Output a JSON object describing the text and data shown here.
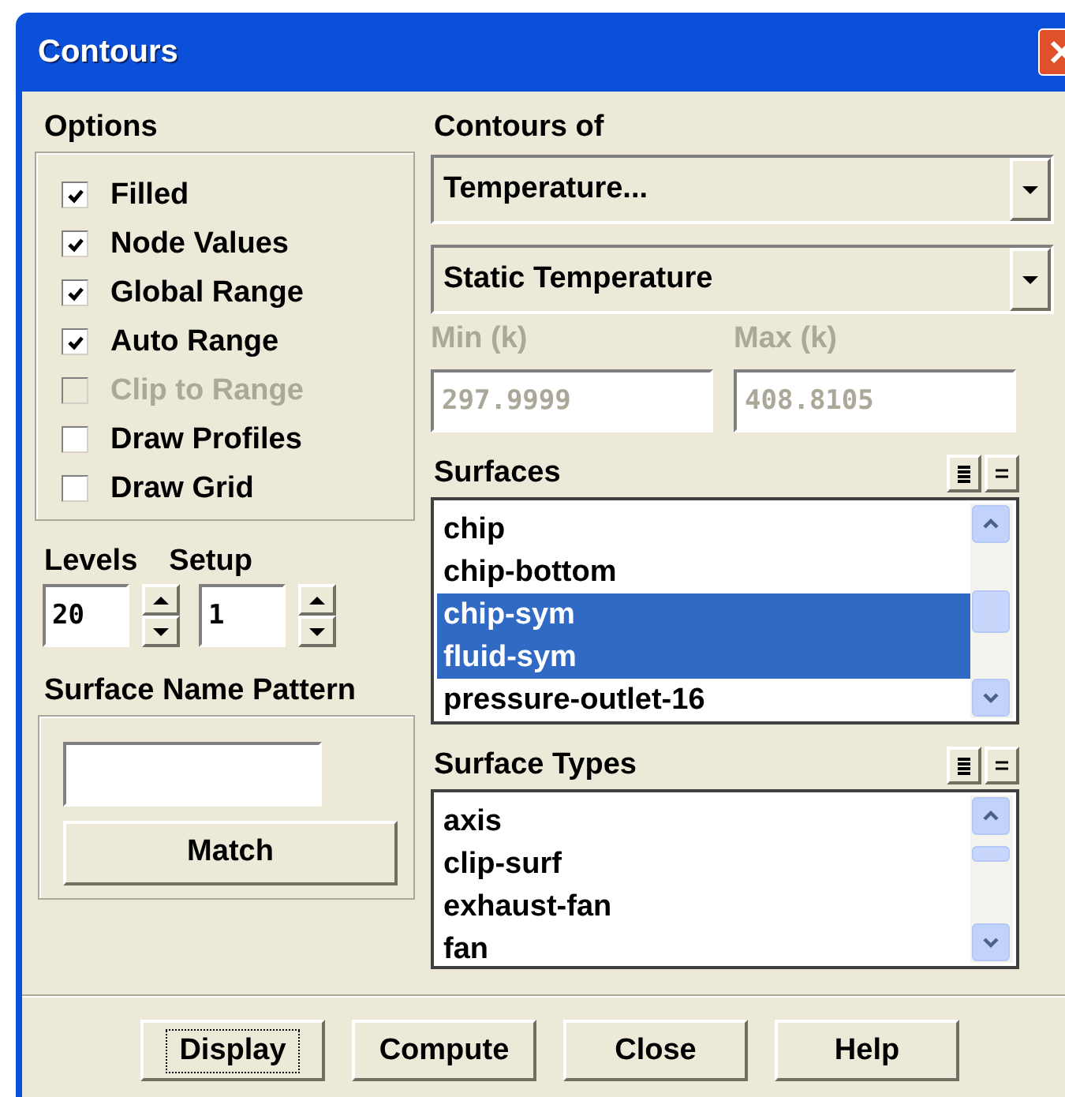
{
  "window": {
    "title": "Contours"
  },
  "options": {
    "label": "Options",
    "items": [
      {
        "label": "Filled",
        "checked": true,
        "disabled": false
      },
      {
        "label": "Node Values",
        "checked": true,
        "disabled": false
      },
      {
        "label": "Global Range",
        "checked": true,
        "disabled": false
      },
      {
        "label": "Auto Range",
        "checked": true,
        "disabled": false
      },
      {
        "label": "Clip to Range",
        "checked": false,
        "disabled": true
      },
      {
        "label": "Draw Profiles",
        "checked": false,
        "disabled": false
      },
      {
        "label": "Draw Grid",
        "checked": false,
        "disabled": false
      }
    ]
  },
  "levels": {
    "label": "Levels",
    "value": "20"
  },
  "setup": {
    "label": "Setup",
    "value": "1"
  },
  "surface_name_pattern": {
    "label": "Surface Name Pattern",
    "button": "Match"
  },
  "contours_of": {
    "label": "Contours of",
    "category": "Temperature...",
    "quantity": "Static Temperature"
  },
  "min": {
    "label": "Min (k)",
    "value": "297.9999",
    "disabled": true
  },
  "max": {
    "label": "Max (k)",
    "value": "408.8105",
    "disabled": true
  },
  "surfaces": {
    "label": "Surfaces",
    "items": [
      {
        "label": "chip",
        "selected": false
      },
      {
        "label": "chip-bottom",
        "selected": false
      },
      {
        "label": "chip-sym",
        "selected": true
      },
      {
        "label": "fluid-sym",
        "selected": true
      },
      {
        "label": "pressure-outlet-16",
        "selected": false
      }
    ]
  },
  "surface_types": {
    "label": "Surface Types",
    "items": [
      {
        "label": "axis",
        "selected": false
      },
      {
        "label": "clip-surf",
        "selected": false
      },
      {
        "label": "exhaust-fan",
        "selected": false
      },
      {
        "label": "fan",
        "selected": false
      }
    ]
  },
  "buttons": [
    {
      "label": "Display",
      "focused": true
    },
    {
      "label": "Compute",
      "focused": false
    },
    {
      "label": "Close",
      "focused": false
    },
    {
      "label": "Help",
      "focused": false
    }
  ]
}
